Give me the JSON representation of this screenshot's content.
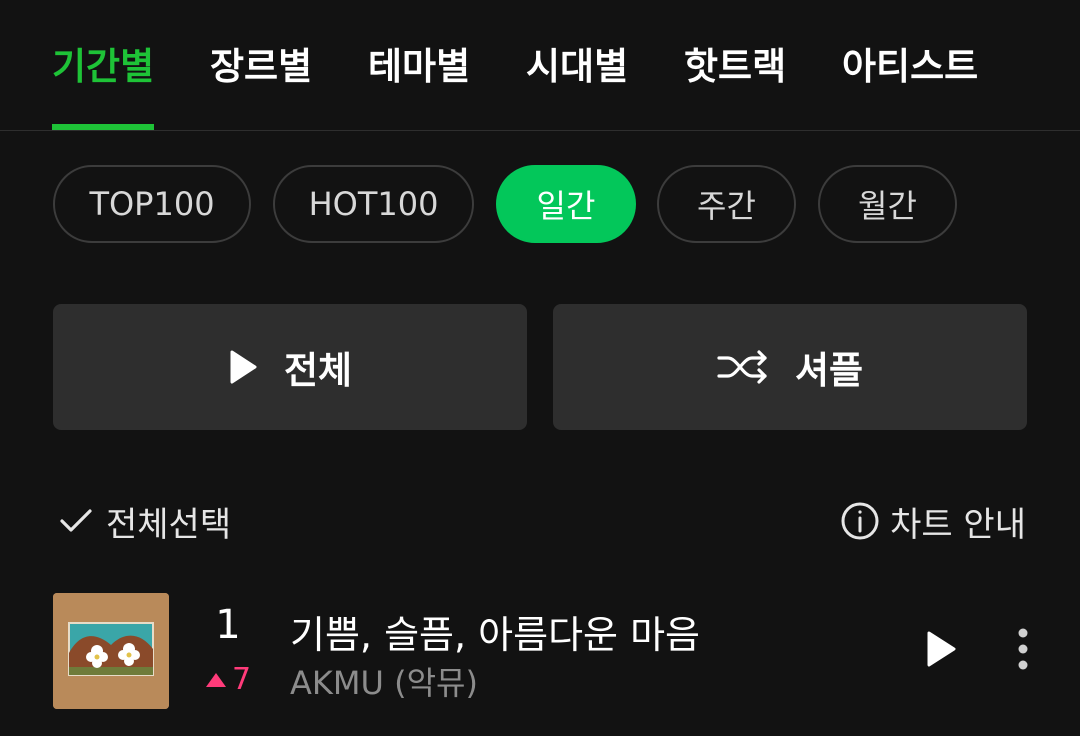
{
  "top_tabs": [
    {
      "label": "기간별",
      "active": true
    },
    {
      "label": "장르별",
      "active": false
    },
    {
      "label": "테마별",
      "active": false
    },
    {
      "label": "시대별",
      "active": false
    },
    {
      "label": "핫트랙",
      "active": false
    },
    {
      "label": "아티스트",
      "active": false
    }
  ],
  "chips": [
    {
      "label": "TOP100",
      "active": false
    },
    {
      "label": "HOT100",
      "active": false
    },
    {
      "label": "일간",
      "active": true
    },
    {
      "label": "주간",
      "active": false
    },
    {
      "label": "월간",
      "active": false
    }
  ],
  "actions": {
    "play_all_label": "전체",
    "play_all_icon": "play-icon",
    "shuffle_label": "셔플",
    "shuffle_icon": "shuffle-icon"
  },
  "toolbar": {
    "select_all_label": "전체선택",
    "select_all_icon": "check-icon",
    "chart_info_label": "차트 안내",
    "chart_info_icon": "info-icon"
  },
  "songs": [
    {
      "rank": "1",
      "rank_change": "7",
      "rank_direction": "up",
      "title": "기쁨, 슬픔, 아름다운 마음",
      "artist": "AKMU (악뮤)"
    }
  ],
  "colors": {
    "accent": "#1ec337",
    "chip_active": "#03c75a",
    "rank_up": "#ff3b7a",
    "background": "#121212"
  }
}
